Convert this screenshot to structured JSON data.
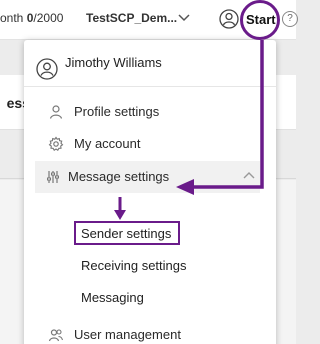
{
  "topbar": {
    "month_prefix": "onth",
    "month_count": "0",
    "month_limit": "/2000",
    "tenant": "TestSCP_Dem...",
    "start_label": "Start",
    "help_glyph": "?"
  },
  "background": {
    "heading_fragment": "ess"
  },
  "menu": {
    "user_name": "Jimothy Williams",
    "items": [
      {
        "label": "Profile settings",
        "icon": "person-icon"
      },
      {
        "label": "My account",
        "icon": "gear-icon"
      },
      {
        "label": "Message settings",
        "icon": "sliders-icon",
        "expanded": true
      },
      {
        "label": "User management",
        "icon": "users-icon"
      }
    ],
    "submenu": [
      {
        "label": "Sender settings",
        "highlighted": true
      },
      {
        "label": "Receiving settings"
      },
      {
        "label": "Messaging"
      }
    ]
  },
  "colors": {
    "annotation": "#6a1b8a",
    "active_row": "#f1f1f1"
  }
}
